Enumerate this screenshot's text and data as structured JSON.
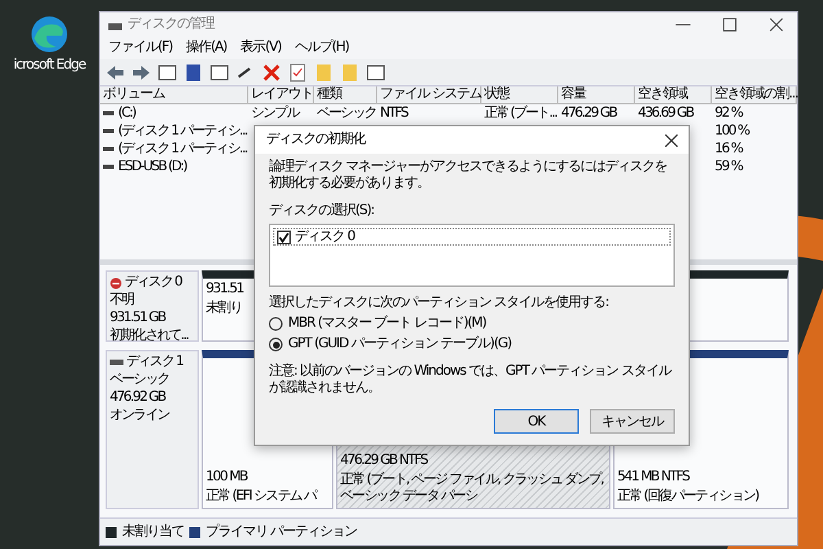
{
  "desktop": {
    "icons": [
      {
        "label": "icrosoft Edge"
      }
    ]
  },
  "window": {
    "title": "ディスクの管理",
    "menu": [
      "ファイル(F)",
      "操作(A)",
      "表示(V)",
      "ヘルプ(H)"
    ]
  },
  "volumes": {
    "columns": [
      "ボリューム",
      "レイアウト",
      "種類",
      "ファイル システム",
      "状態",
      "容量",
      "空き領域",
      "空き領域の割..."
    ],
    "rows": [
      {
        "volume": "(C:)",
        "layout": "シンプル",
        "type": "ベーシック",
        "file_system": "NTFS",
        "status": "正常 (ブート...",
        "capacity": "476.29 GB",
        "free_space": "436.69 GB",
        "free_pct": "92 %"
      },
      {
        "volume": "(ディスク 1 パーティシ...",
        "free_pct": "100 %"
      },
      {
        "volume": "(ディスク 1 パーティシ...",
        "free_pct": "16 %"
      },
      {
        "volume": "ESD-USB (D:)",
        "free_pct": "59 %"
      }
    ]
  },
  "disks": [
    {
      "name": "ディスク 0",
      "kind": "unknown",
      "lines": [
        "不明",
        "931.51 GB",
        "初期化されて..."
      ],
      "partitions": [
        {
          "kind": "unallocated",
          "selected": false,
          "lines": [
            "931.51",
            "未割り"
          ]
        }
      ]
    },
    {
      "name": "ディスク 1",
      "kind": "basic",
      "lines": [
        "ベーシック",
        "476.92 GB",
        "オンライン"
      ],
      "partitions": [
        {
          "kind": "primary",
          "selected": false,
          "lines": [
            "100 MB",
            "正常 (EFI システム パ"
          ]
        },
        {
          "kind": "primary",
          "selected": true,
          "lines": [
            "476.29 GB NTFS",
            "正常 (ブート, ページ ファイル, クラッシュ ダンプ, ベーシック データ パーシ"
          ]
        },
        {
          "kind": "primary",
          "selected": false,
          "lines": [
            "541 MB NTFS",
            "正常 (回復パーティション)"
          ]
        }
      ]
    }
  ],
  "legend": [
    {
      "label": "未割り当て",
      "color": "#1e2628"
    },
    {
      "label": "プライマリ パーティション",
      "color": "#24407a"
    }
  ],
  "dialog": {
    "title": "ディスクの初期化",
    "message": "論理ディスク マネージャーがアクセスできるようにするにはディスクを初期化する必要があります。",
    "select_label": "ディスクの選択(S):",
    "disks": [
      {
        "label": "ディスク 0",
        "checked": true
      }
    ],
    "style_label": "選択したディスクに次のパーティション スタイルを使用する:",
    "styles": [
      {
        "label": "MBR (マスター ブート レコード)(M)",
        "selected": false
      },
      {
        "label": "GPT (GUID パーティション テーブル)(G)",
        "selected": true
      }
    ],
    "note": "注意: 以前のバージョンの Windows では、GPT パーティション スタイルが認識されません。",
    "buttons": [
      {
        "label": "OK",
        "default": true
      },
      {
        "label": "キャンセル",
        "default": false
      }
    ]
  }
}
